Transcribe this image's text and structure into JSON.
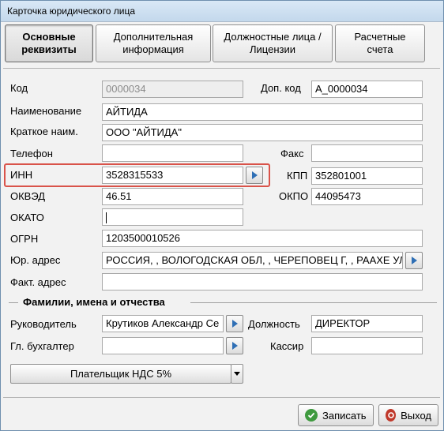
{
  "window": {
    "title": "Карточка юридического лица"
  },
  "tabs": [
    {
      "label": "Основные\nреквизиты",
      "active": true
    },
    {
      "label": "Дополнительная\nинформация",
      "active": false
    },
    {
      "label": "Должностные лица /\nЛицензии",
      "active": false
    },
    {
      "label": "Расчетные\nсчета",
      "active": false
    }
  ],
  "fields": {
    "code": {
      "label": "Код",
      "value": "0000034"
    },
    "add_code": {
      "label": "Доп. код",
      "value": "A_0000034"
    },
    "name": {
      "label": "Наименование",
      "value": "АЙТИДА"
    },
    "short_name": {
      "label": "Краткое наим.",
      "value": "ООО \"АЙТИДА\""
    },
    "phone": {
      "label": "Телефон",
      "value": ""
    },
    "fax": {
      "label": "Факс",
      "value": ""
    },
    "inn": {
      "label": "ИНН",
      "value": "3528315533"
    },
    "kpp": {
      "label": "КПП",
      "value": "352801001"
    },
    "okved": {
      "label": "ОКВЭД",
      "value": "46.51"
    },
    "okpo": {
      "label": "ОКПО",
      "value": "44095473"
    },
    "okato": {
      "label": "ОКАТО",
      "value": ""
    },
    "ogrn": {
      "label": "ОГРН",
      "value": "1203500010526"
    },
    "legal_address": {
      "label": "Юр. адрес",
      "value": "РОССИЯ, , ВОЛОГОДСКАЯ ОБЛ, , ЧЕРЕПОВЕЦ Г, , РААХЕ УЛ, Д"
    },
    "actual_address": {
      "label": "Факт. адрес",
      "value": ""
    }
  },
  "people": {
    "group_title": "Фамилии,  имена и отчества",
    "director": {
      "label": "Руководитель",
      "value": "Крутиков Александр Се"
    },
    "position": {
      "label": "Должность",
      "value": "ДИРЕКТОР"
    },
    "accountant": {
      "label": "Гл. бухгалтер",
      "value": ""
    },
    "cashier": {
      "label": "Кассир",
      "value": ""
    }
  },
  "vat_button": {
    "label": "Плательщик НДС 5%"
  },
  "actions": {
    "save": "Записать",
    "exit": "Выход"
  },
  "colors": {
    "highlight": "#d9534a",
    "save_icon": "#3f9a3f",
    "exit_icon": "#c0392b",
    "arrow": "#2f6fb5"
  }
}
